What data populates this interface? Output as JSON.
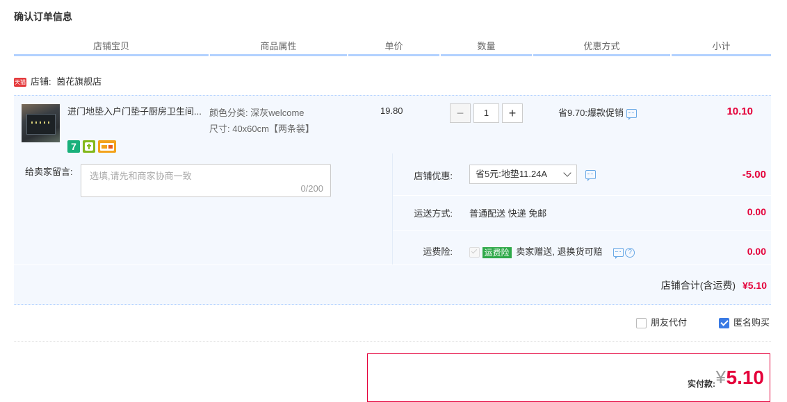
{
  "page": {
    "title": "确认订单信息"
  },
  "table_headers": [
    "店铺宝贝",
    "商品属性",
    "单价",
    "数量",
    "优惠方式",
    "小计"
  ],
  "shop": {
    "badge": "天猫",
    "label": "店铺:",
    "name": "茵花旗舰店"
  },
  "item": {
    "title": "进门地垫入户门垫子厨房卫生间...",
    "attr_color": "颜色分类: 深灰welcome",
    "attr_size": "尺寸: 40x60cm【两条装】",
    "badge_7": "7",
    "price": "19.80",
    "quantity": "1",
    "qty_minus": "−",
    "qty_plus": "+",
    "promo": "省9.70:爆款促销",
    "subtotal": "10.10"
  },
  "message": {
    "label": "给卖家留言:",
    "placeholder": "选填,请先和商家协商一致",
    "counter": "0/200"
  },
  "shop_discount": {
    "label": "店铺优惠:",
    "selected": "省5元:地垫11.24A",
    "amount": "-5.00"
  },
  "shipping": {
    "label": "运送方式:",
    "value": "普通配送 快递 免邮",
    "amount": "0.00"
  },
  "insurance": {
    "label": "运费险:",
    "tag": "运费险",
    "text": "卖家赠送, 退换货可赔",
    "help": "?",
    "amount": "0.00"
  },
  "shop_total": {
    "label": "店铺合计(含运费)",
    "value": "¥5.10"
  },
  "options": {
    "friend_pay": {
      "label": "朋友代付",
      "checked": false
    },
    "anonymous": {
      "label": "匿名购买",
      "checked": true
    }
  },
  "payment": {
    "label": "实付款:",
    "currency": "¥",
    "value": "5.10"
  },
  "colors": {
    "accent_red": "#e4003a",
    "header_border": "#b2d1ff",
    "row_bg": "#f4f8fe",
    "checkbox_blue": "#3a7ae4"
  }
}
